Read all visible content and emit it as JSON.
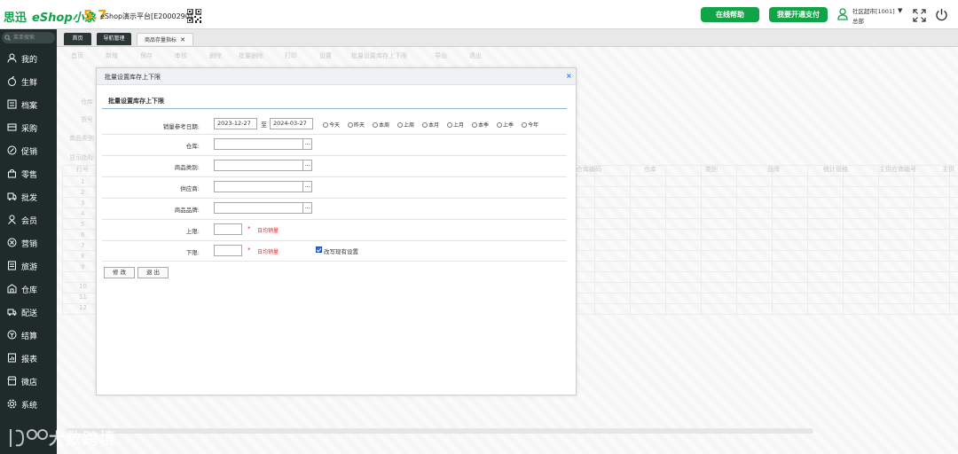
{
  "header": {
    "logo_cn": "思迅",
    "logo_shop": "eShop小象",
    "version": "5.7",
    "platform": "eShop演示平台[E2000290]",
    "help_button": "在线帮助",
    "pay_button": "我要开通支付",
    "store_name": "社区超市[1001]",
    "role": "总部"
  },
  "sidebar": {
    "search_placeholder": "菜单搜索",
    "items": [
      {
        "label": "我的",
        "icon": "user-icon"
      },
      {
        "label": "生鲜",
        "icon": "apple-icon"
      },
      {
        "label": "档案",
        "icon": "folder-icon"
      },
      {
        "label": "采购",
        "icon": "cart-icon"
      },
      {
        "label": "促销",
        "icon": "discount-icon"
      },
      {
        "label": "零售",
        "icon": "bag-icon"
      },
      {
        "label": "批发",
        "icon": "truck-icon"
      },
      {
        "label": "会员",
        "icon": "member-icon"
      },
      {
        "label": "营销",
        "icon": "target-icon"
      },
      {
        "label": "旅游",
        "icon": "document-icon"
      },
      {
        "label": "仓库",
        "icon": "warehouse-icon"
      },
      {
        "label": "配送",
        "icon": "delivery-icon"
      },
      {
        "label": "结算",
        "icon": "coin-icon"
      },
      {
        "label": "报表",
        "icon": "report-icon"
      },
      {
        "label": "微店",
        "icon": "shop-icon"
      },
      {
        "label": "系统",
        "icon": "gear-icon"
      }
    ]
  },
  "tabs": [
    {
      "label": "首页"
    },
    {
      "label": "导航管理"
    },
    {
      "label": "商品存量指标"
    }
  ],
  "background": {
    "toolbar": [
      "首页",
      "新增",
      "保存",
      "审核",
      "删除",
      "批量删除",
      "打印",
      "设置",
      "批量设置库存上下限",
      "导出",
      "退出"
    ],
    "filters": [
      "仓库",
      "货号",
      "商品类别",
      "显示指标"
    ],
    "grid_header": [
      "行号",
      "仓库编码",
      "仓库",
      "类别",
      "品牌",
      "统计规格",
      "主供应商编号",
      "主供"
    ],
    "row_numbers": [
      "1",
      "2",
      "3",
      "4",
      "5",
      "6",
      "7",
      "8",
      "9",
      "10",
      "11",
      "12"
    ]
  },
  "dialog": {
    "title": "批量设置库存上下限",
    "section_title": "批量设置库存上下限",
    "sales_date_label": "销量参考日期:",
    "date_from": "2023-12-27",
    "to_label": "至",
    "date_to": "2024-03-27",
    "quick_ranges": [
      "今天",
      "昨天",
      "本周",
      "上周",
      "本月",
      "上月",
      "本季",
      "上季",
      "今年"
    ],
    "warehouse_label": "仓库:",
    "category_label": "商品类别:",
    "supplier_label": "供应商:",
    "brand_label": "商品品牌:",
    "upper_label": "上限:",
    "lower_label": "下限:",
    "required_mark": "*",
    "daily_sales_hint": "日均销量",
    "overwrite_label": "改写现有设置",
    "overwrite_checked": true,
    "modify_button": "修 改",
    "exit_button": "退 出",
    "lookup_button": "..."
  },
  "watermark": "大数跨境"
}
